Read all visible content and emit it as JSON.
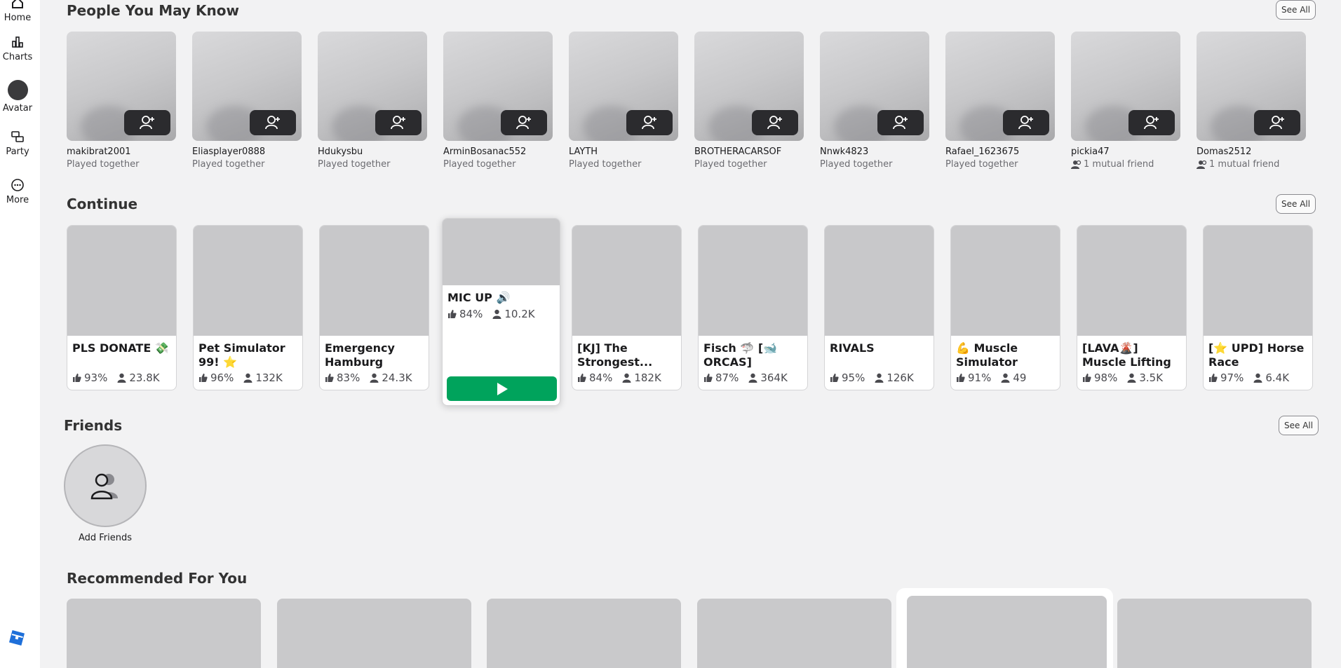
{
  "sidebar": {
    "items": [
      {
        "label": "Home",
        "icon": "home-icon"
      },
      {
        "label": "Charts",
        "icon": "charts-icon"
      },
      {
        "label": "Avatar",
        "icon": "avatar-icon"
      },
      {
        "label": "Party",
        "icon": "party-icon"
      },
      {
        "label": "More",
        "icon": "more-icon"
      }
    ],
    "logo": "roblox-logo"
  },
  "people": {
    "title": "People You May Know",
    "see_all": "See All",
    "list": [
      {
        "name": "makibrat2001",
        "sub": "Played together"
      },
      {
        "name": "Eliasplayer0888",
        "sub": "Played together"
      },
      {
        "name": "Hdukysbu",
        "sub": "Played together"
      },
      {
        "name": "ArminBosanac552",
        "sub": "Played together"
      },
      {
        "name": "LAYTH",
        "sub": "Played together"
      },
      {
        "name": "BROTHERACARSOF",
        "sub": "Played together"
      },
      {
        "name": "Nnwk4823",
        "sub": "Played together"
      },
      {
        "name": "Rafael_1623675",
        "sub": "Played together"
      },
      {
        "name": "pickia47",
        "sub": "1 mutual friend"
      },
      {
        "name": "Domas2512",
        "sub": "1 mutual friend"
      }
    ]
  },
  "continue": {
    "title": "Continue",
    "see_all": "See All",
    "games": [
      {
        "name": "PLS DONATE 💸",
        "rating": "93%",
        "players": "23.8K"
      },
      {
        "name": "Pet Simulator 99! ⭐",
        "rating": "96%",
        "players": "132K"
      },
      {
        "name": "Emergency Hamburg",
        "rating": "83%",
        "players": "24.3K"
      },
      {
        "name": "MIC UP 🔊",
        "rating": "84%",
        "players": "10.2K"
      },
      {
        "name": "[KJ] The Strongest...",
        "rating": "84%",
        "players": "182K"
      },
      {
        "name": "Fisch 🦈 [🐋 ORCAS]",
        "rating": "87%",
        "players": "364K"
      },
      {
        "name": "RIVALS",
        "rating": "95%",
        "players": "126K"
      },
      {
        "name": "💪 Muscle Simulator",
        "rating": "91%",
        "players": "49"
      },
      {
        "name": "[LAVA🌋] Muscle Lifting Simulator",
        "rating": "98%",
        "players": "3.5K"
      },
      {
        "name": "[⭐ UPD] Horse Race",
        "rating": "97%",
        "players": "6.4K"
      }
    ]
  },
  "friends": {
    "title": "Friends",
    "see_all": "See All",
    "add_label": "Add Friends"
  },
  "recommended": {
    "title": "Recommended For You"
  }
}
